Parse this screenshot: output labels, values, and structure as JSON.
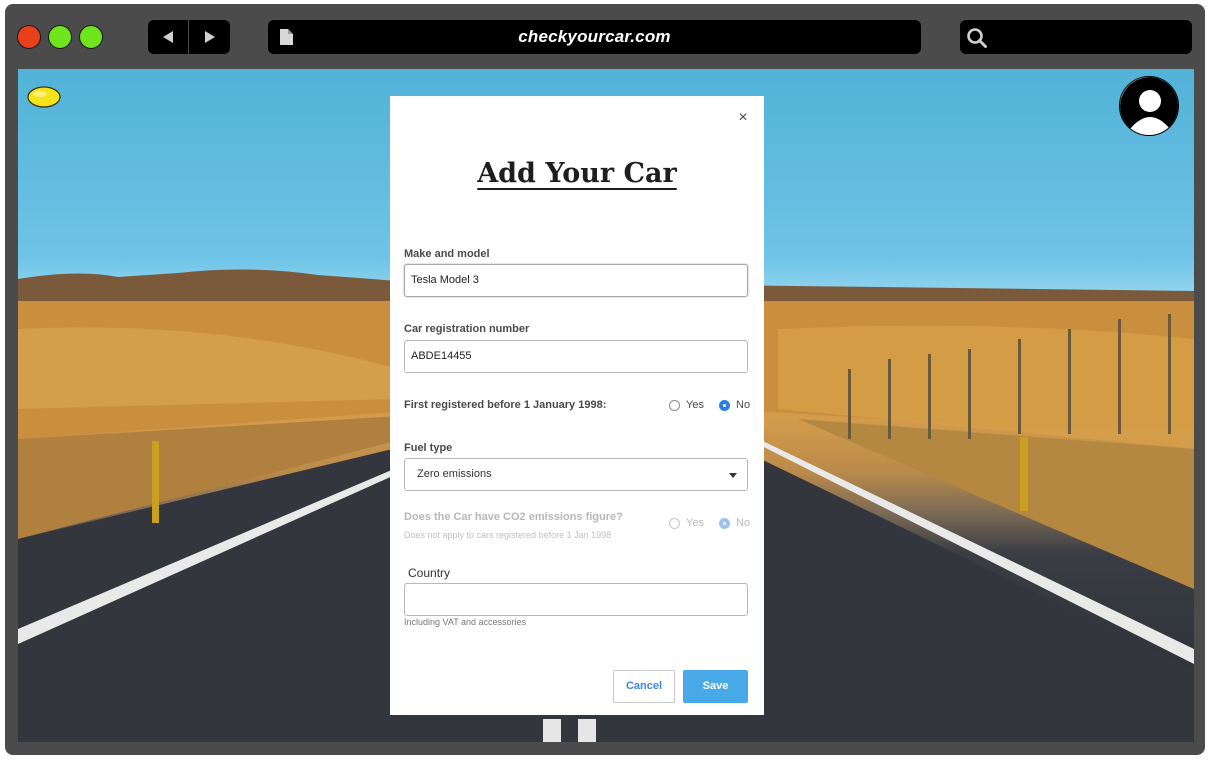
{
  "browser": {
    "url": "checkyourcar.com",
    "traffic_lights": [
      "close",
      "minimize",
      "maximize"
    ],
    "icons": {
      "back": "back-arrow-icon",
      "forward": "forward-arrow-icon",
      "document": "document-icon",
      "search": "search-icon"
    }
  },
  "page": {
    "logo_icon": "lemon-icon",
    "avatar_icon": "user-avatar-icon"
  },
  "modal": {
    "close_label": "×",
    "title": "Add Your Car",
    "make_model": {
      "label": "Make and model",
      "value": "Tesla Model 3"
    },
    "registration": {
      "label": "Car registration number",
      "value": "ABDE14455"
    },
    "first_registered": {
      "label": "First registered before 1 January 1998:",
      "options": [
        "Yes",
        "No"
      ],
      "selected": "No"
    },
    "fuel_type": {
      "label": "Fuel type",
      "value": "Zero emissions"
    },
    "co2": {
      "label": "Does the Car have CO2 emissions figure?",
      "help": "Does not apply to cars registered before 1 Jan 1998",
      "options": [
        "Yes",
        "No"
      ],
      "selected": "No",
      "disabled": true
    },
    "country": {
      "label": "Country",
      "value": "",
      "help": "Including VAT and accessories"
    },
    "cancel_label": "Cancel",
    "save_label": "Save"
  },
  "colors": {
    "primary": "#48a9e9",
    "radio_selected": "#2d7fe0",
    "window_frame": "#4b4b4b"
  }
}
